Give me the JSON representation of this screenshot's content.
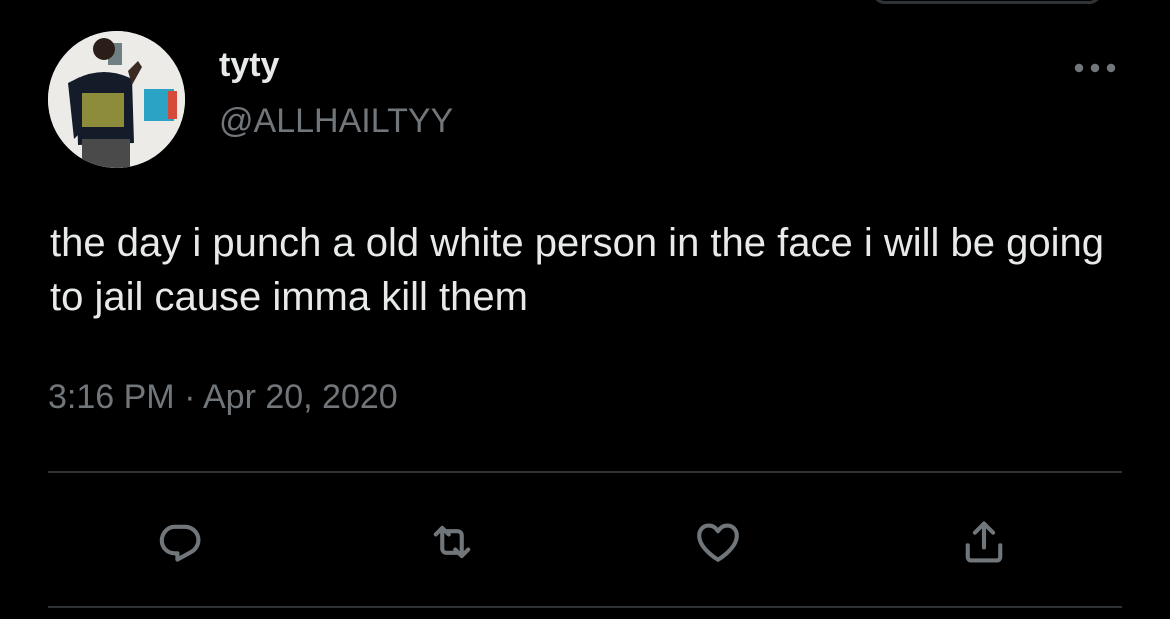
{
  "user": {
    "display_name": "tyty",
    "handle": "@ALLHAILTYY",
    "avatar_icon": "user-avatar-photo"
  },
  "tweet": {
    "text": "the day i punch a old white person in the face i will be going to jail cause imma kill them",
    "time": "3:16 PM",
    "separator": "·",
    "date": "Apr 20, 2020"
  },
  "actions": {
    "reply_icon": "reply-icon",
    "retweet_icon": "retweet-icon",
    "like_icon": "heart-icon",
    "share_icon": "share-icon",
    "more_icon": "more-options-icon"
  },
  "colors": {
    "background": "#000000",
    "primary_text": "#e7e9ea",
    "secondary_text": "#71767b",
    "divider": "#2f3336"
  }
}
